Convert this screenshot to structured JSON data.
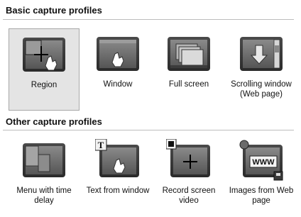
{
  "basic": {
    "header": "Basic capture profiles",
    "items": [
      {
        "label": "Region",
        "icon": "region-capture-icon",
        "selected": true
      },
      {
        "label": "Window",
        "icon": "window-capture-icon"
      },
      {
        "label": "Full screen",
        "icon": "full-screen-capture-icon"
      },
      {
        "label": "Scrolling window\n(Web page)",
        "icon": "scrolling-window-capture-icon"
      }
    ]
  },
  "other": {
    "header": "Other capture profiles",
    "items": [
      {
        "label": "Menu with time\ndelay",
        "icon": "menu-time-delay-icon"
      },
      {
        "label": "Text from window",
        "icon": "text-from-window-icon"
      },
      {
        "label": "Record screen\nvideo",
        "icon": "record-screen-video-icon"
      },
      {
        "label": "Images from Web\npage",
        "icon": "images-from-web-icon"
      }
    ]
  },
  "colors": {
    "frame": "#3a3a3a",
    "screen": "#6f6f6f",
    "selected_bg": "#e4e4e4"
  }
}
